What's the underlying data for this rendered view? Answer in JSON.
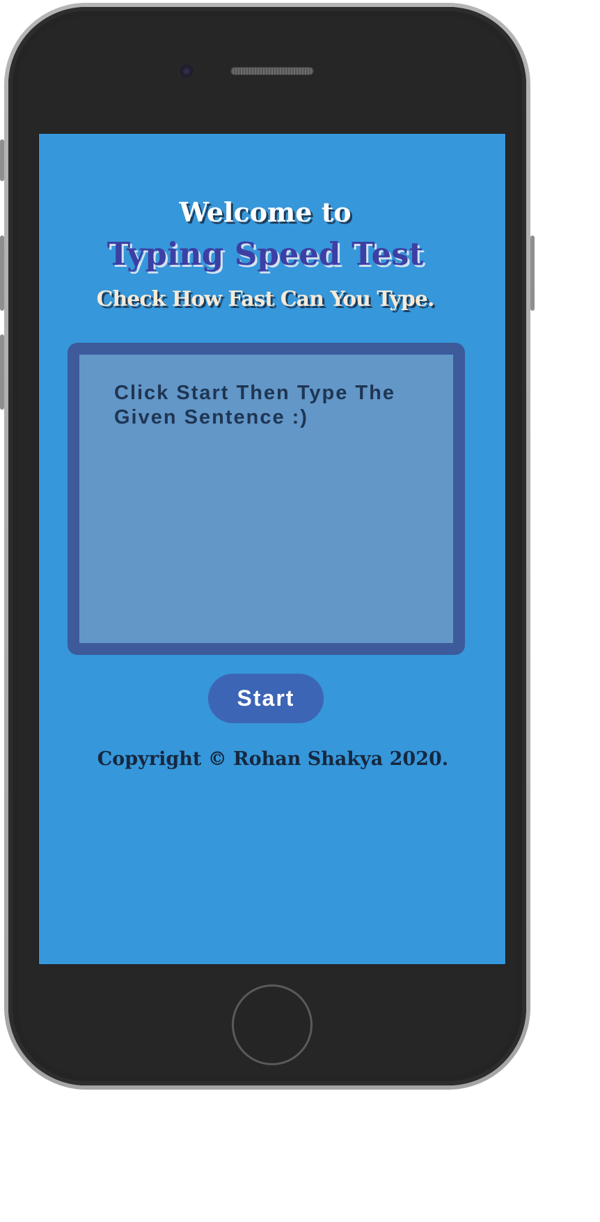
{
  "header": {
    "welcome": "Welcome to",
    "title": "Typing Speed Test",
    "subtitle": "Check How Fast Can You Type."
  },
  "typing_area": {
    "prompt": "Click Start Then Type The Given Sentence  :)"
  },
  "controls": {
    "start_label": "Start"
  },
  "footer": {
    "copyright": "Copyright © Rohan Shakya 2020."
  },
  "colors": {
    "screen_background": "#3697da",
    "box_border": "#3d5a9b",
    "box_fill": "#6297c8",
    "button": "#3d65b5",
    "title": "#3c3fa3"
  }
}
